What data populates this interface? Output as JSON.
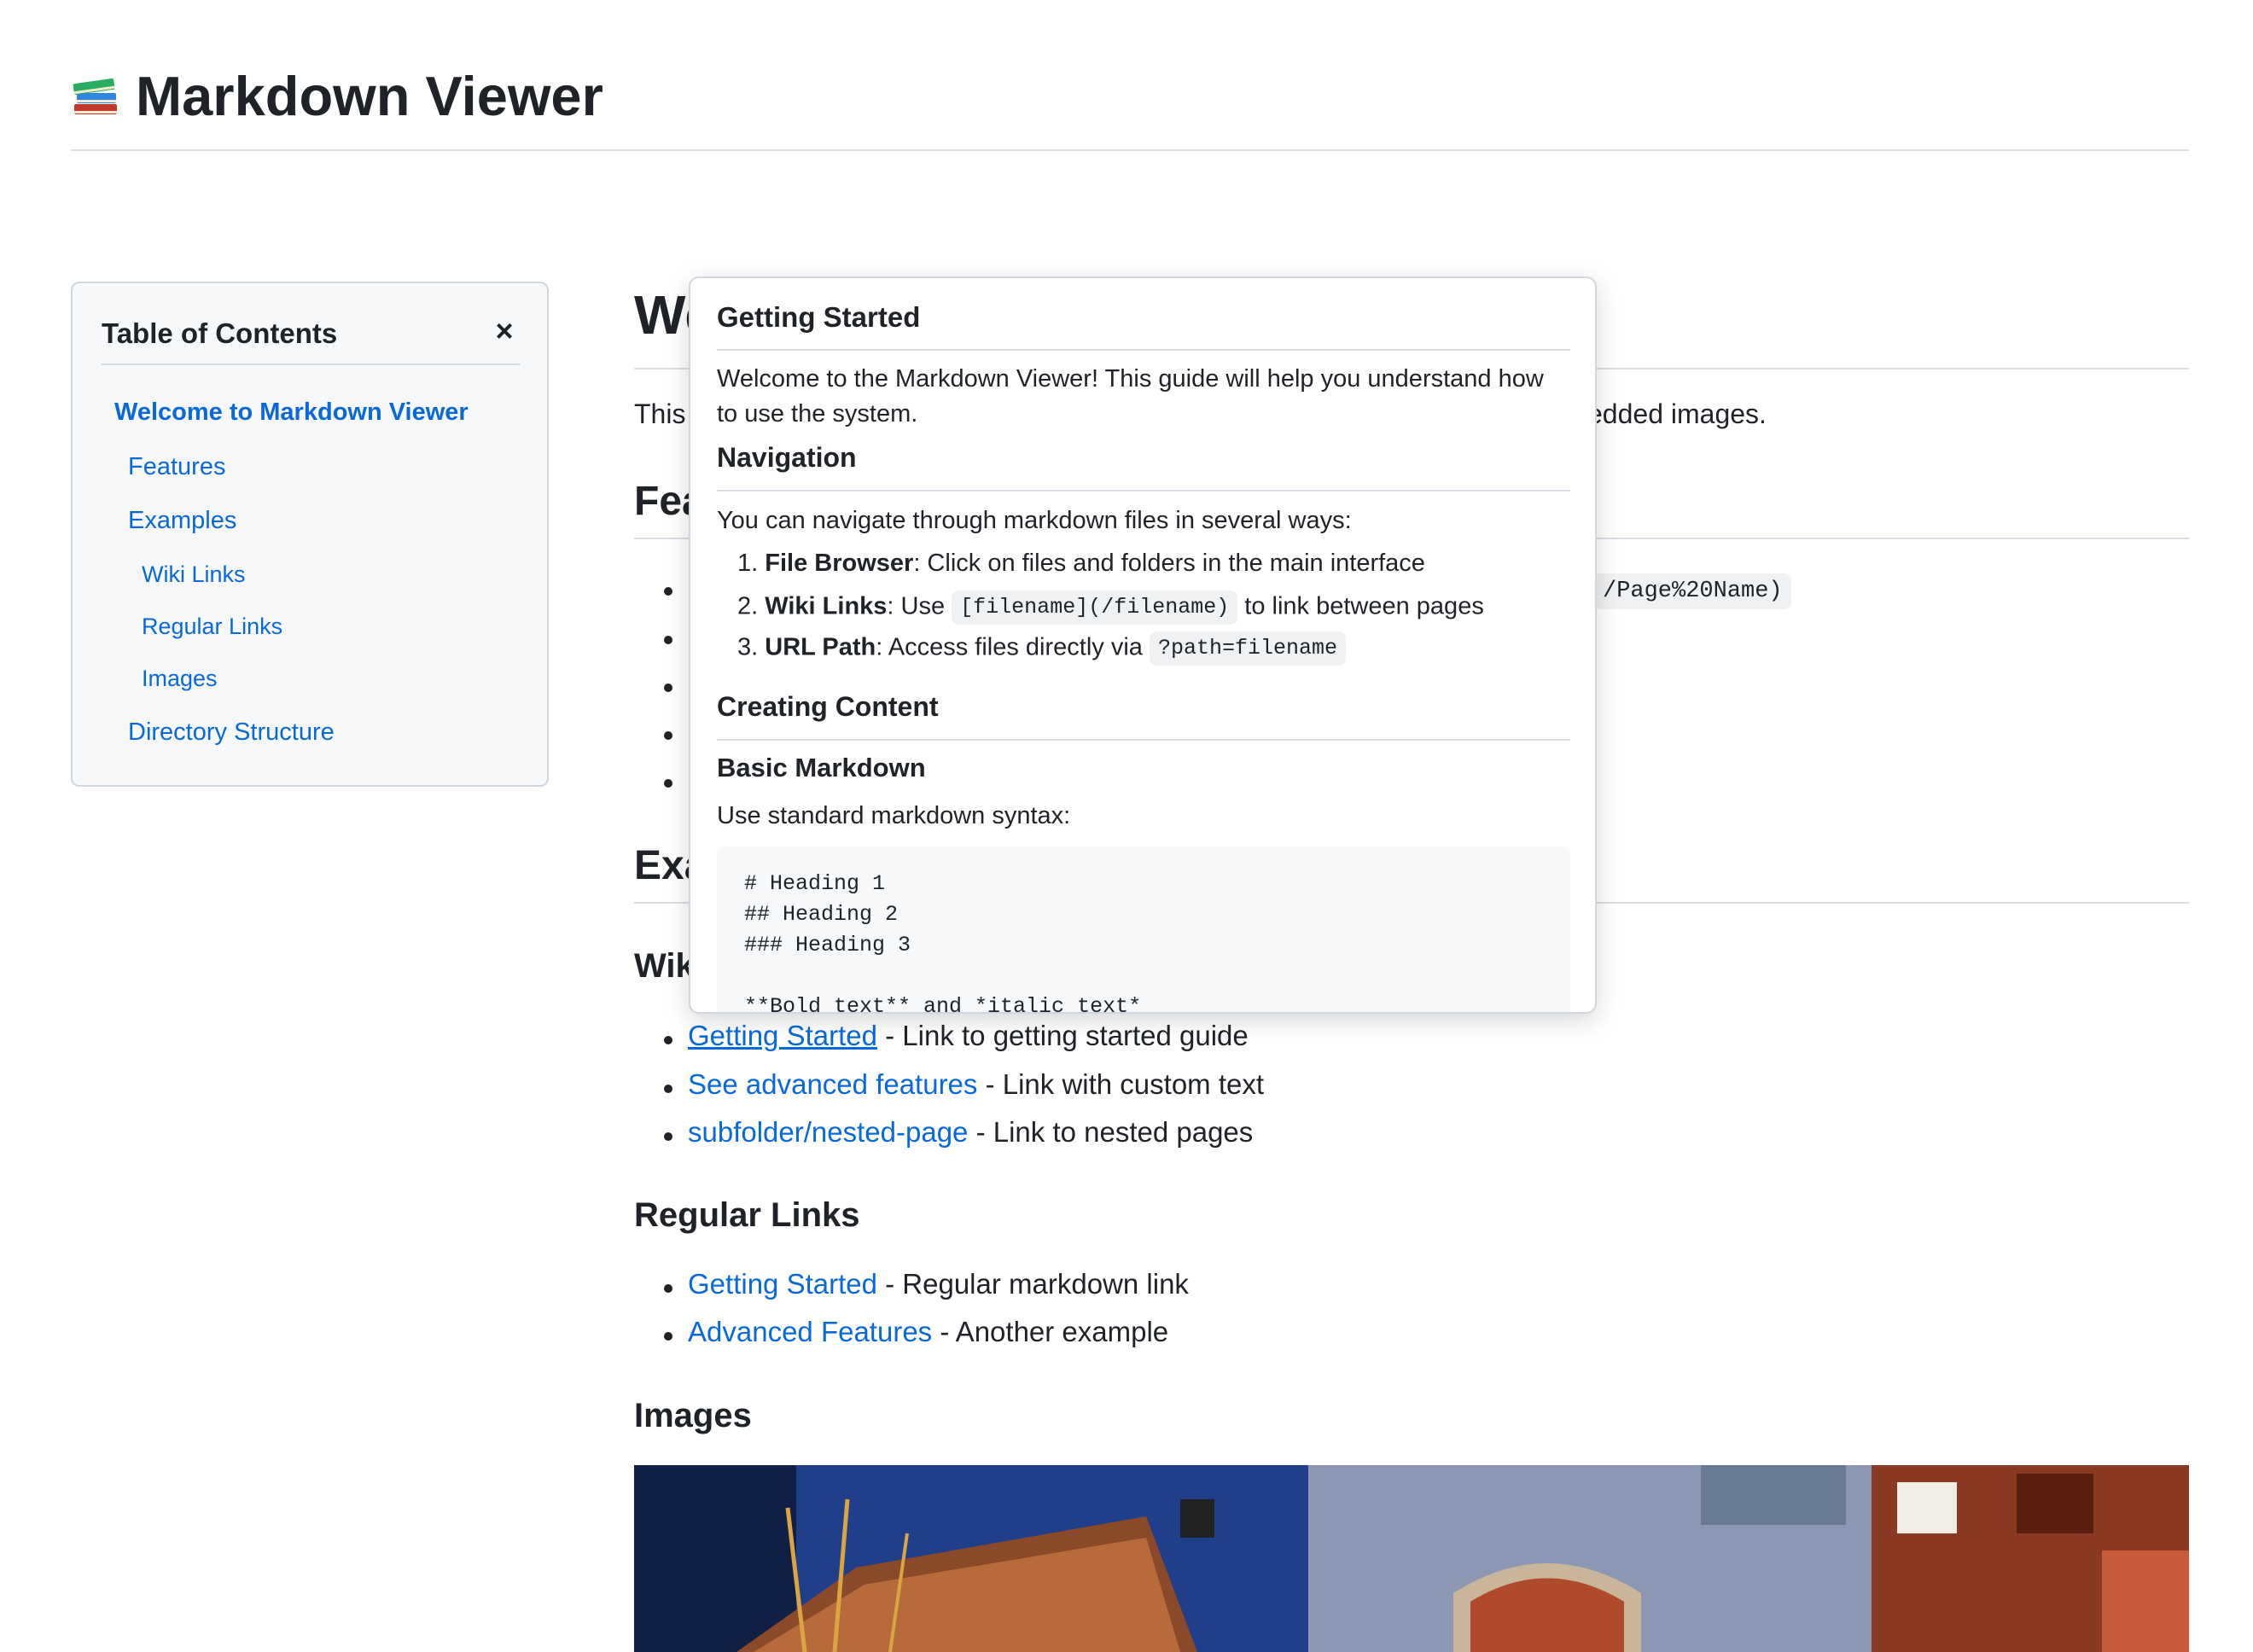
{
  "header": {
    "title": "Markdown Viewer",
    "icon": "books-icon"
  },
  "toc": {
    "title": "Table of Contents",
    "close_symbol": "×",
    "items": [
      {
        "label": "Welcome to Markdown Viewer",
        "level": 1
      },
      {
        "label": "Features",
        "level": 2
      },
      {
        "label": "Examples",
        "level": 2
      },
      {
        "label": "Wiki Links",
        "level": 3
      },
      {
        "label": "Regular Links",
        "level": 3
      },
      {
        "label": "Images",
        "level": 3
      },
      {
        "label": "Directory Structure",
        "level": 2
      }
    ]
  },
  "content": {
    "h1_visible": "We",
    "intro_visible_start": "This",
    "intro_visible_end": "edded images.",
    "features_heading_visible": "Fea",
    "features_code_visible": "/Page%20Name)",
    "examples_heading_visible": "Exa",
    "wiki_heading_visible": "Wik",
    "wiki_links": [
      {
        "link": "Getting Started",
        "desc": " - Link to getting started guide"
      },
      {
        "link": "See advanced features",
        "desc": " - Link with custom text"
      },
      {
        "link": "subfolder/nested-page",
        "desc": " - Link to nested pages"
      }
    ],
    "regular_links_heading": "Regular Links",
    "regular_links": [
      {
        "link": "Getting Started",
        "desc": " - Regular markdown link"
      },
      {
        "link": "Advanced Features",
        "desc": " - Another example"
      }
    ],
    "images_heading": "Images"
  },
  "popup": {
    "title": "Getting Started",
    "intro_line1": "Welcome to the Markdown Viewer! This guide will help you understand how",
    "intro_line2": "to use the system.",
    "nav_heading": "Navigation",
    "nav_intro": "You can navigate through markdown files in several ways:",
    "nav_items": [
      {
        "num": "1.",
        "bold": "File Browser",
        "text": ": Click on files and folders in the main interface",
        "code": "",
        "after": ""
      },
      {
        "num": "2.",
        "bold": "Wiki Links",
        "text": ": Use ",
        "code": "[filename](/filename)",
        "after": " to link between pages"
      },
      {
        "num": "3.",
        "bold": "URL Path",
        "text": ": Access files directly via ",
        "code": "?path=filename",
        "after": ""
      }
    ],
    "creating_heading": "Creating Content",
    "basic_heading": "Basic Markdown",
    "basic_text": "Use standard markdown syntax:",
    "code_lines": [
      "# Heading 1",
      "## Heading 2",
      "### Heading 3",
      "",
      "**Bold text** and *italic text*"
    ]
  }
}
